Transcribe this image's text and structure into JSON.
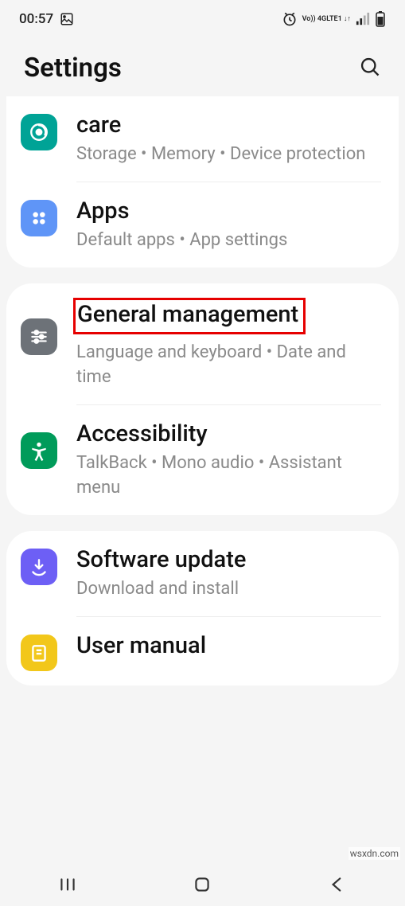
{
  "status": {
    "time": "00:57",
    "network_label": "Vo)) 4G",
    "network_sub": "LTE1 ↓↑"
  },
  "header": {
    "title": "Settings"
  },
  "group1": {
    "care": {
      "title": "care",
      "sub": "Storage  •  Memory  •  Device protection"
    },
    "apps": {
      "title": "Apps",
      "sub": "Default apps  •  App settings"
    }
  },
  "group2": {
    "general": {
      "title": "General management",
      "sub": "Language and keyboard  •  Date and time"
    },
    "accessibility": {
      "title": "Accessibility",
      "sub": "TalkBack  •  Mono audio  •  Assistant menu"
    }
  },
  "group3": {
    "software": {
      "title": "Software update",
      "sub": "Download and install"
    },
    "manual": {
      "title": "User manual"
    }
  },
  "watermark": "wsxdn.com"
}
